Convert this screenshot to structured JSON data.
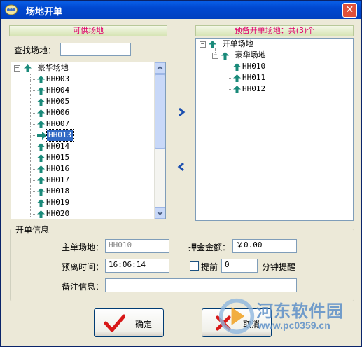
{
  "window": {
    "title": "场地开单",
    "close_glyph": "✕"
  },
  "left_panel": {
    "header": "可供场地",
    "search_label": "查找场地：",
    "search_value": "",
    "tree": {
      "root": "豪华场地",
      "items": [
        "HH003",
        "HH004",
        "HH005",
        "HH006",
        "HH007",
        "HH013",
        "HH014",
        "HH015",
        "HH016",
        "HH017",
        "HH018",
        "HH019",
        "HH020"
      ],
      "selected": "HH013"
    }
  },
  "right_panel": {
    "header": "预备开单场地：共(3)个",
    "tree": {
      "root": "开单场地",
      "group": "豪华场地",
      "items": [
        "HH010",
        "HH011",
        "HH012"
      ]
    }
  },
  "transfer": {
    "add_icon": "chevron-right-icon",
    "remove_icon": "chevron-left-icon"
  },
  "order_info": {
    "group_title": "开单信息",
    "main_venue_label": "主单场地：",
    "main_venue_value": "HH010",
    "deposit_label": "押金金额：",
    "deposit_value": "￥0.00",
    "leave_time_label": "预离时间：",
    "leave_time_value": "16:06:14",
    "remind_checkbox_label": "提前",
    "remind_checked": false,
    "remind_minutes_value": "0",
    "remind_suffix": "分钟提醒",
    "note_label": "备注信息：",
    "note_value": ""
  },
  "buttons": {
    "ok_label": "确定",
    "cancel_label": "取消"
  },
  "watermark": {
    "text": "河东软件园",
    "url": "www.pc0359.cn"
  },
  "colors": {
    "titlebar": "#0048d0",
    "panel_header_text": "#e0006a",
    "selected": "#316ac5",
    "accent_icon": "#1a8a7a"
  }
}
